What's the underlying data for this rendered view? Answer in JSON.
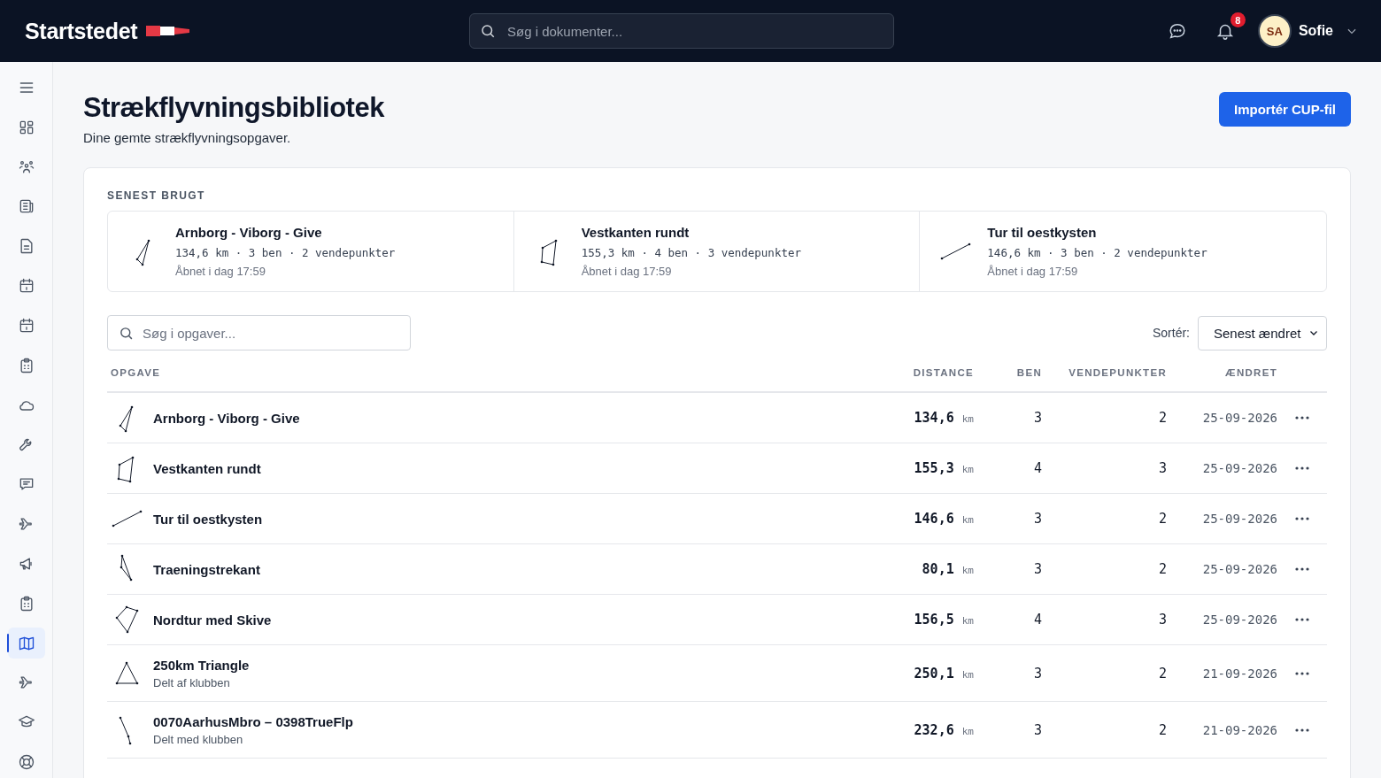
{
  "header": {
    "logo": "Startstedet",
    "search": {
      "placeholder": "Søg i dokumenter..."
    },
    "notifications": "8",
    "user": {
      "initials": "SA",
      "name": "Sofie"
    }
  },
  "sidebar": {
    "items": [
      {
        "kind": "menu",
        "selected": false
      },
      {
        "kind": "dashboard",
        "selected": false
      },
      {
        "kind": "people",
        "selected": false
      },
      {
        "kind": "news",
        "selected": false
      },
      {
        "kind": "document",
        "selected": false
      },
      {
        "kind": "calendar",
        "selected": false
      },
      {
        "kind": "calendar",
        "selected": false
      },
      {
        "kind": "clipboard",
        "selected": false
      },
      {
        "kind": "cloud",
        "selected": false
      },
      {
        "kind": "wrench",
        "selected": false
      },
      {
        "kind": "chat",
        "selected": false
      },
      {
        "kind": "plane",
        "selected": false
      },
      {
        "kind": "megaphone",
        "selected": false
      },
      {
        "kind": "clipboard",
        "selected": false
      },
      {
        "kind": "map",
        "selected": true
      },
      {
        "kind": "plane",
        "selected": false
      },
      {
        "kind": "cap",
        "selected": false
      },
      {
        "kind": "lifebuoy",
        "selected": false
      }
    ]
  },
  "page": {
    "title": "Strækflyvningsbibliotek",
    "subtitle": "Dine gemte strækflyvningsopgaver.",
    "import_button": "Importér CUP-fil"
  },
  "recent": {
    "heading": "SENEST BRUGT",
    "items": [
      {
        "name": "Arnborg - Viborg - Give",
        "kind": "slim-triangle",
        "stats": "134,6 km · 3 ben · 2 vendepunkter",
        "opened": "Åbnet i dag 17:59"
      },
      {
        "name": "Vestkanten rundt",
        "kind": "quadrilateral",
        "stats": "155,3 km · 4 ben · 3 vendepunkter",
        "opened": "Åbnet i dag 17:59"
      },
      {
        "name": "Tur til oestkysten",
        "kind": "line",
        "stats": "146,6 km · 3 ben · 2 vendepunkter",
        "opened": "Åbnet i dag 17:59"
      }
    ]
  },
  "tasks": {
    "search": {
      "placeholder": "Søg i opgaver..."
    },
    "sort_label": "Sortér:",
    "sort_value": "Senest ændret",
    "columns": [
      "OPGAVE",
      "DISTANCE",
      "BEN",
      "VENDEPUNKTER",
      "ÆNDRET"
    ],
    "rows": [
      {
        "name": "Arnborg - Viborg - Give",
        "kind": "slim-triangle",
        "distance": "134,6",
        "unit": "km",
        "legs": "3",
        "turnpoints": "2",
        "changed": "25-09-2026"
      },
      {
        "name": "Vestkanten rundt",
        "kind": "quadrilateral",
        "distance": "155,3",
        "unit": "km",
        "legs": "4",
        "turnpoints": "3",
        "changed": "25-09-2026"
      },
      {
        "name": "Tur til oestkysten",
        "kind": "line",
        "distance": "146,6",
        "unit": "km",
        "legs": "3",
        "turnpoints": "2",
        "changed": "25-09-2026"
      },
      {
        "name": "Traeningstrekant",
        "kind": "narrow-triangle",
        "distance": "80,1",
        "unit": "km",
        "legs": "3",
        "turnpoints": "2",
        "changed": "25-09-2026"
      },
      {
        "name": "Nordtur med Skive",
        "kind": "diamond",
        "distance": "156,5",
        "unit": "km",
        "legs": "4",
        "turnpoints": "3",
        "changed": "25-09-2026"
      },
      {
        "name": "250km Triangle",
        "note": "Delt af klubben",
        "kind": "triangle",
        "distance": "250,1",
        "unit": "km",
        "legs": "3",
        "turnpoints": "2",
        "changed": "21-09-2026"
      },
      {
        "name": "0070AarhusMbro – 0398TrueFlp",
        "note": "Delt med klubben",
        "kind": "steep-line",
        "distance": "232,6",
        "unit": "km",
        "legs": "3",
        "turnpoints": "2",
        "changed": "21-09-2026"
      }
    ]
  }
}
